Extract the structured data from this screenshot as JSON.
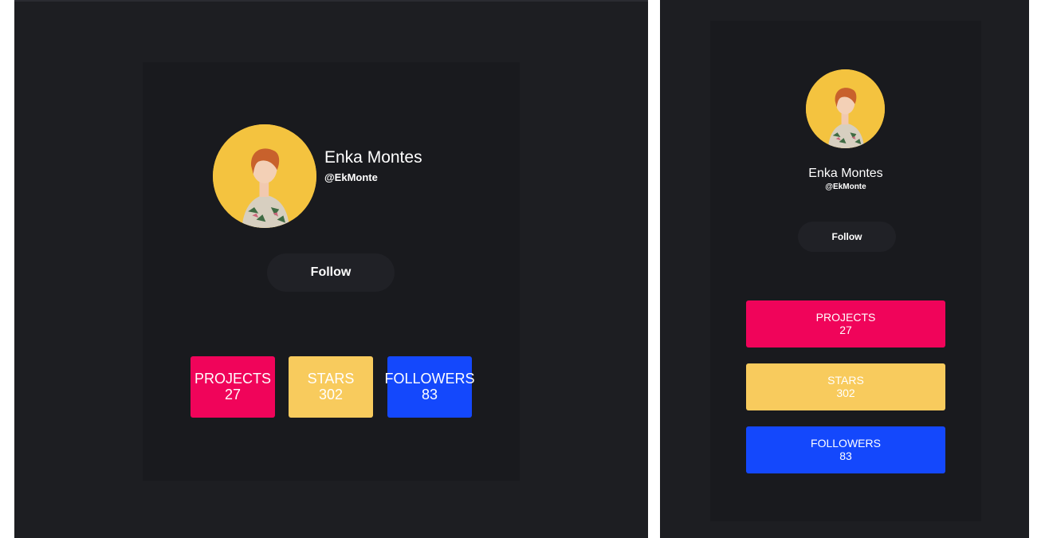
{
  "profile": {
    "name": "Enka Montes",
    "handle": "@EkMonte",
    "follow_label": "Follow",
    "avatar_icon": "person-photo-icon"
  },
  "stats": [
    {
      "label": "PROJECTS",
      "value": "27",
      "color": "#f0045a"
    },
    {
      "label": "STARS",
      "value": "302",
      "color": "#f8cb5d"
    },
    {
      "label": "FOLLOWERS",
      "value": "83",
      "color": "#1448fc"
    }
  ],
  "colors": {
    "page_bg": "#1d1e22",
    "card_bg": "#191a1e",
    "button_bg": "#202126",
    "avatar_bg": "#f4c33f"
  }
}
